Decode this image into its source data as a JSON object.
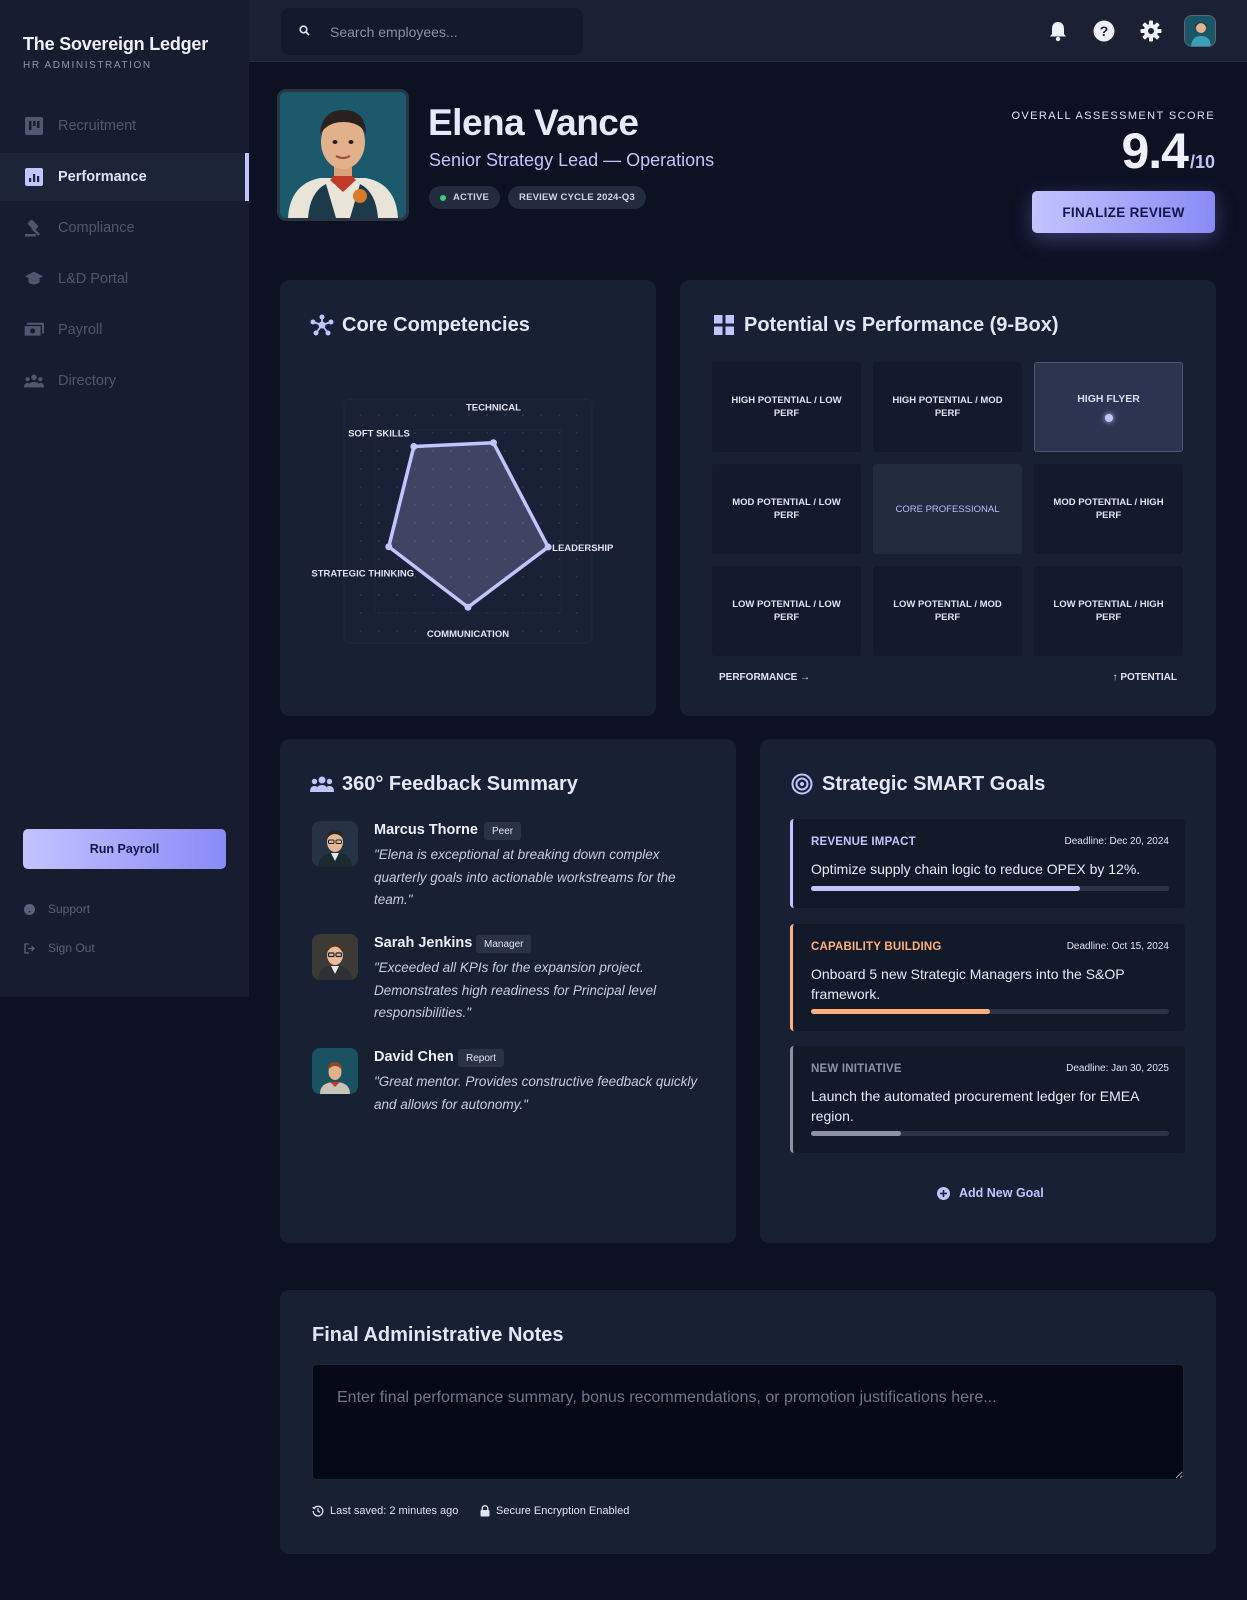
{
  "brand": {
    "title": "The Sovereign Ledger",
    "subtitle": "HR ADMINISTRATION"
  },
  "sidebar": {
    "items": [
      {
        "label": "Recruitment",
        "icon": "board-icon"
      },
      {
        "label": "Performance",
        "icon": "chart-icon",
        "active": true
      },
      {
        "label": "Compliance",
        "icon": "gavel-icon"
      },
      {
        "label": "L&D Portal",
        "icon": "graduation-cap-icon"
      },
      {
        "label": "Payroll",
        "icon": "money-icon"
      },
      {
        "label": "Directory",
        "icon": "people-icon"
      }
    ],
    "run_payroll": "Run Payroll",
    "support": "Support",
    "sign_out": "Sign Out"
  },
  "search": {
    "placeholder": "Search employees..."
  },
  "employee": {
    "name": "Elena Vance",
    "role": "Senior Strategy Lead — Operations",
    "status": "ACTIVE",
    "cycle": "REVIEW CYCLE 2024-Q3"
  },
  "score": {
    "label": "OVERALL ASSESSMENT SCORE",
    "value": "9.4",
    "max": "/10"
  },
  "finalize_label": "FINALIZE REVIEW",
  "competencies": {
    "title": "Core Competencies",
    "axes": [
      "TECHNICAL",
      "LEADERSHIP",
      "COMMUNICATION",
      "STRATEGIC THINKING",
      "SOFT SKILLS"
    ],
    "values": [
      0.84,
      0.86,
      0.88,
      0.85,
      0.94
    ],
    "colors": {
      "stroke": "#c2c4ff",
      "fill": "rgba(194,196,255,0.22)"
    }
  },
  "ninebox": {
    "title": "Potential vs Performance (9-Box)",
    "cells": [
      [
        "HIGH POTENTIAL / LOW PERF",
        "HIGH POTENTIAL / MOD PERF",
        "HIGH FLYER"
      ],
      [
        "MOD POTENTIAL / LOW PERF",
        "CORE PROFESSIONAL",
        "MOD POTENTIAL / HIGH PERF"
      ],
      [
        "LOW POTENTIAL / LOW PERF",
        "LOW POTENTIAL / MOD PERF",
        "LOW POTENTIAL / HIGH PERF"
      ]
    ],
    "x_axis": "PERFORMANCE →",
    "y_axis": "↑ POTENTIAL"
  },
  "feedback": {
    "title": "360° Feedback Summary",
    "items": [
      {
        "name": "Marcus Thorne",
        "role": "Peer",
        "quote": "\"Elena is exceptional at breaking down complex quarterly goals into actionable workstreams for the team.\""
      },
      {
        "name": "Sarah Jenkins",
        "role": "Manager",
        "quote": "\"Exceeded all KPIs for the expansion project. Demonstrates high readiness for Principal level responsibilities.\""
      },
      {
        "name": "David Chen",
        "role": "Report",
        "quote": "\"Great mentor. Provides constructive feedback quickly and allows for autonomy.\""
      }
    ]
  },
  "goals": {
    "title": "Strategic SMART Goals",
    "items": [
      {
        "category": "REVENUE IMPACT",
        "deadline": "Deadline: Dec 20, 2024",
        "text": "Optimize supply chain logic to reduce OPEX by 12%.",
        "progress": 0.75,
        "color": "#c2c4ff"
      },
      {
        "category": "CAPABILITY BUILDING",
        "deadline": "Deadline: Oct 15, 2024",
        "text": "Onboard 5 new Strategic Managers into the S&OP framework.",
        "progress": 0.5,
        "color": "#ffb07a"
      },
      {
        "category": "NEW INITIATIVE",
        "deadline": "Deadline: Jan 30, 2025",
        "text": "Launch the automated procurement ledger for EMEA region.",
        "progress": 0.25,
        "color": "#8e93a3"
      }
    ],
    "add_label": "Add New Goal"
  },
  "notes": {
    "title": "Final Administrative Notes",
    "placeholder": "Enter final performance summary, bonus recommendations, or promotion justifications here...",
    "last_saved": "Last saved: 2 minutes ago",
    "encryption": "Secure Encryption Enabled"
  }
}
